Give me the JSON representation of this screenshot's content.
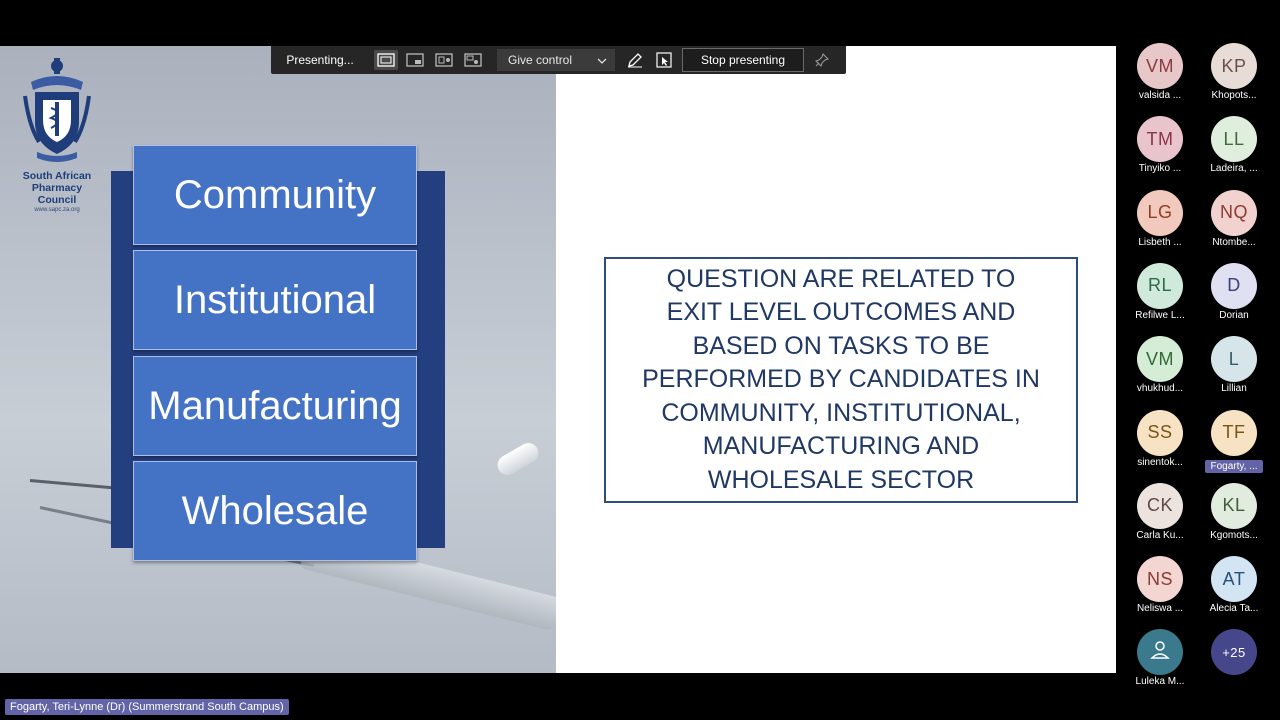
{
  "toolbar": {
    "presenting_label": "Presenting...",
    "give_control_label": "Give control",
    "stop_presenting_label": "Stop presenting"
  },
  "slide": {
    "logo": {
      "org_line1": "South African",
      "org_line2": "Pharmacy Council",
      "url": "www.sapc.za.org"
    },
    "sectors": [
      "Community",
      "Institutional",
      "Manufacturing",
      "Wholesale"
    ],
    "question_lines": [
      "QUESTION ARE RELATED TO",
      "EXIT LEVEL OUTCOMES AND",
      "BASED ON TASKS TO BE",
      "PERFORMED BY CANDIDATES IN",
      "COMMUNITY, INSTITUTIONAL,",
      "MANUFACTURING AND",
      "WHOLESALE SECTOR"
    ]
  },
  "participants": [
    {
      "initials": "VM",
      "name": "valsida ...",
      "bg": "#e8c7c9",
      "fg": "#8a3b3e"
    },
    {
      "initials": "KP",
      "name": "Khopots...",
      "bg": "#e8dcd7",
      "fg": "#6d5149"
    },
    {
      "initials": "TM",
      "name": "Tinyiko ...",
      "bg": "#e9c4cc",
      "fg": "#8a3447"
    },
    {
      "initials": "LL",
      "name": "Ladeira, ...",
      "bg": "#dfeedd",
      "fg": "#3f6b39"
    },
    {
      "initials": "LG",
      "name": "Lisbeth ...",
      "bg": "#f2c9bd",
      "fg": "#8f3f26"
    },
    {
      "initials": "NQ",
      "name": "Ntombe...",
      "bg": "#f2d2cf",
      "fg": "#8e3b33"
    },
    {
      "initials": "RL",
      "name": "Refilwe L...",
      "bg": "#cfe9db",
      "fg": "#2f6b4a"
    },
    {
      "initials": "D",
      "name": "Dorian",
      "bg": "#dfe0f2",
      "fg": "#3d3f7a"
    },
    {
      "initials": "VM",
      "name": "vhukhud...",
      "bg": "#d5ecd6",
      "fg": "#2f6b35"
    },
    {
      "initials": "L",
      "name": "Lillian",
      "bg": "#d6e5ea",
      "fg": "#35596a"
    },
    {
      "initials": "SS",
      "name": "sinentok...",
      "bg": "#f7e3c3",
      "fg": "#7a5416"
    },
    {
      "initials": "TF",
      "name": "Fogarty, ...",
      "bg": "#f7e3c3",
      "fg": "#7a5416"
    },
    {
      "initials": "CK",
      "name": "Carla Ku...",
      "bg": "#ece2de",
      "fg": "#5f4a43"
    },
    {
      "initials": "KL",
      "name": "Kgomots...",
      "bg": "#e1ecdf",
      "fg": "#3f5e39"
    },
    {
      "initials": "NS",
      "name": "Neliswa ...",
      "bg": "#f3d6d2",
      "fg": "#8a3b32"
    },
    {
      "initials": "AT",
      "name": "Alecia Ta...",
      "bg": "#d3e4f3",
      "fg": "#27507a"
    },
    {
      "initials": "",
      "name": "Luleka M...",
      "bg": "#3a7a8c",
      "fg": "#ffffff",
      "icon": "person-icon"
    },
    {
      "initials": "+25",
      "name": "",
      "bg": "#46478a",
      "fg": "#ffffff"
    }
  ],
  "presenter_label": "Fogarty, Teri-Lynne (Dr) (Summerstrand South Campus)"
}
